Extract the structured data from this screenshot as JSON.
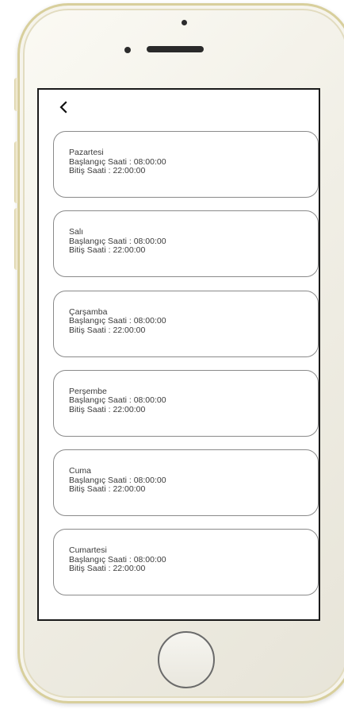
{
  "nav": {
    "back_symbol": "<"
  },
  "days": [
    {
      "name": "Pazartesi",
      "start": "Başlangıç Saati : 08:00:00",
      "end": "Bitiş Saati : 22:00:00"
    },
    {
      "name": "Salı",
      "start": "Başlangıç Saati : 08:00:00",
      "end": "Bitiş Saati : 22:00:00"
    },
    {
      "name": "Çarşamba",
      "start": "Başlangıç Saati : 08:00:00",
      "end": "Bitiş Saati : 22:00:00"
    },
    {
      "name": "Perşembe",
      "start": "Başlangıç Saati : 08:00:00",
      "end": "Bitiş Saati : 22:00:00"
    },
    {
      "name": "Cuma",
      "start": "Başlangıç Saati : 08:00:00",
      "end": "Bitiş Saati : 22:00:00"
    },
    {
      "name": "Cumartesi",
      "start": "Başlangıç Saati : 08:00:00",
      "end": "Bitiş Saati : 22:00:00"
    }
  ],
  "colors": {
    "phone_frame": "#f1efe6",
    "phone_trim": "#d8cf9c",
    "card_border": "#8a8a8a",
    "text": "#3a3a3a"
  },
  "icons": {
    "back": "chevron-left-icon",
    "home": "home-button-ring"
  }
}
